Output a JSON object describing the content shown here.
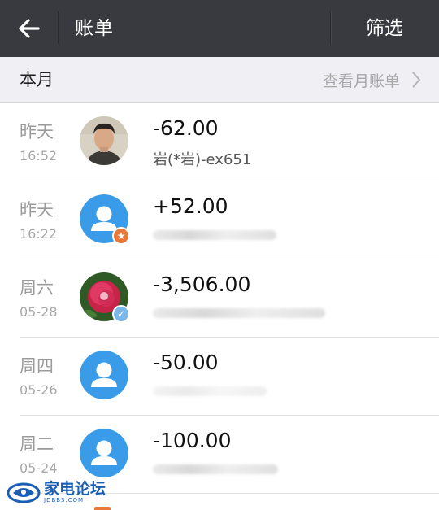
{
  "header": {
    "back_icon": "arrow-left-icon",
    "title": "账单",
    "filter_label": "筛选",
    "bg_color": "#393a3f"
  },
  "month_bar": {
    "label": "本月",
    "link_label": "查看月账单",
    "chevron_icon": "chevron-right-icon"
  },
  "transactions": [
    {
      "day": "昨天",
      "time": "16:52",
      "amount": "-62.00",
      "desc": "岩(*岩)-ex651",
      "avatar": "photo-portrait",
      "badge": ""
    },
    {
      "day": "昨天",
      "time": "16:22",
      "amount": "+52.00",
      "desc": "",
      "avatar": "default-user-icon",
      "badge": "star-badge-icon"
    },
    {
      "day": "周六",
      "time": "05-28",
      "amount": "-3,506.00",
      "desc": "",
      "avatar": "photo-flower",
      "badge": "verified-badge-icon"
    },
    {
      "day": "周四",
      "time": "05-26",
      "amount": "-50.00",
      "desc": "",
      "avatar": "default-user-icon",
      "badge": ""
    },
    {
      "day": "周二",
      "time": "05-24",
      "amount": "-100.00",
      "desc": "",
      "avatar": "default-user-icon",
      "badge": ""
    }
  ],
  "watermark": {
    "text": "家电论坛",
    "sub": "JDBBS.COM"
  },
  "colors": {
    "accent_blue": "#3a9ce8",
    "star_orange": "#e8793a",
    "verified_blue": "#7bb8e8"
  }
}
